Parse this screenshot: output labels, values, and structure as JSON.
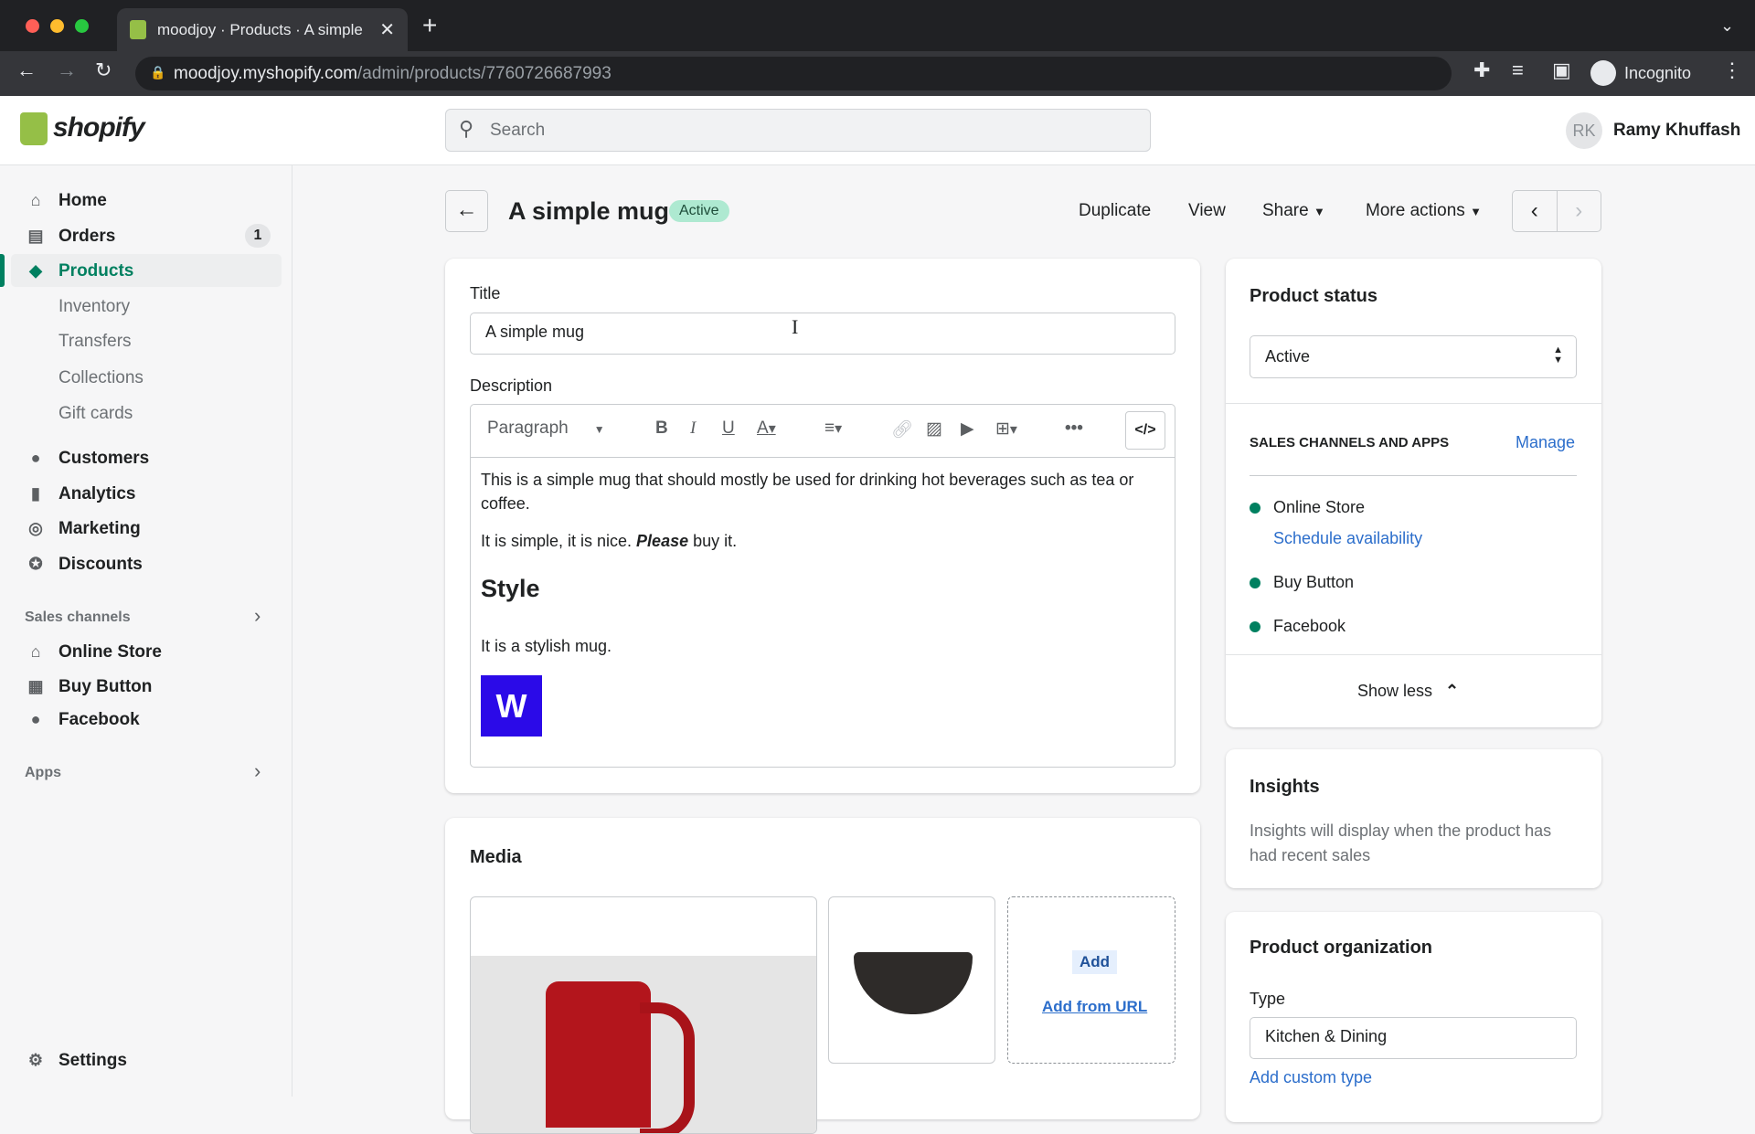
{
  "browser": {
    "tab_title": "moodjoy · Products · A simple mug",
    "url_host": "moodjoy.myshopify.com",
    "url_path": "/admin/products/7760726687993",
    "profile": "Incognito"
  },
  "header": {
    "logo": "shopify",
    "search_placeholder": "Search",
    "avatar_initials": "RK",
    "user_name": "Ramy Khuffash"
  },
  "sidebar": {
    "items": [
      {
        "label": "Home",
        "icon": "home-icon"
      },
      {
        "label": "Orders",
        "icon": "orders-icon",
        "badge": "1"
      },
      {
        "label": "Products",
        "icon": "tag-icon",
        "active": true
      },
      {
        "label": "Inventory"
      },
      {
        "label": "Transfers"
      },
      {
        "label": "Collections"
      },
      {
        "label": "Gift cards"
      },
      {
        "label": "Customers",
        "icon": "person-icon"
      },
      {
        "label": "Analytics",
        "icon": "bar-chart-icon"
      },
      {
        "label": "Marketing",
        "icon": "target-icon"
      },
      {
        "label": "Discounts",
        "icon": "discount-icon"
      }
    ],
    "sales_channels_label": "Sales channels",
    "channels": [
      {
        "label": "Online Store"
      },
      {
        "label": "Buy Button"
      },
      {
        "label": "Facebook"
      }
    ],
    "apps_label": "Apps",
    "settings_label": "Settings"
  },
  "page": {
    "title": "A simple mug",
    "status_badge": "Active",
    "actions": {
      "duplicate": "Duplicate",
      "view": "View",
      "share": "Share",
      "more": "More actions"
    }
  },
  "product": {
    "title_label": "Title",
    "title_value": "A simple mug",
    "description_label": "Description",
    "format": "Paragraph",
    "desc_p1": "This is a simple mug that should mostly be used for drinking hot beverages such as tea or coffee.",
    "desc_p2a": "It is simple, it is nice. ",
    "desc_p2b": "Please",
    "desc_p2c": " buy it.",
    "desc_h": "Style",
    "desc_p3": "It is a stylish mug."
  },
  "media": {
    "title": "Media",
    "add": "Add",
    "add_url": "Add from URL"
  },
  "status_card": {
    "title": "Product status",
    "value": "Active",
    "channels_heading": "SALES CHANNELS AND APPS",
    "manage": "Manage",
    "channels": [
      "Online Store",
      "Buy Button",
      "Facebook"
    ],
    "schedule": "Schedule availability",
    "show_less": "Show less",
    "dot_color": "#008060"
  },
  "insights": {
    "title": "Insights",
    "text": "Insights will display when the product has had recent sales"
  },
  "organization": {
    "title": "Product organization",
    "type_label": "Type",
    "type_value": "Kitchen & Dining",
    "add_custom": "Add custom type"
  },
  "colors": {
    "accent": "#008060",
    "badge_bg": "#aee9d1",
    "link": "#2c6ecb"
  }
}
